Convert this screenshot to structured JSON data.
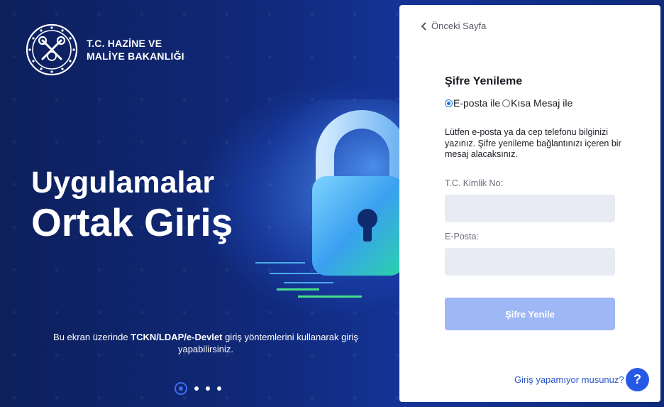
{
  "brand": {
    "name_line1": "T.C. HAZİNE VE",
    "name_line2": "MALİYE BAKANLIĞI"
  },
  "hero": {
    "title_line1": "Uygulamalar",
    "title_line2": "Ortak Giriş",
    "desc_prefix": "Bu ekran üzerinde ",
    "desc_bold": "TCKN/LDAP/e-Devlet",
    "desc_suffix": " giriş yöntemlerini kullanarak giriş yapabilirsiniz.",
    "slides_count": 4,
    "active_slide": 1
  },
  "card": {
    "back_label": "Önceki Sayfa",
    "title": "Şifre Yenileme",
    "radio_email": "E-posta ile",
    "radio_sms": "Kısa Mesaj ile",
    "selected_method": "email",
    "info_text": "Lütfen e-posta ya da cep telefonu bilginizi yazınız. Şifre yenileme bağlantınızı içeren bir mesaj alacaksınız.",
    "tckn_label": "T.C. Kimlik No:",
    "tckn_value": "",
    "email_label": "E-Posta:",
    "email_value": "",
    "submit_label": "Şifre Yenile",
    "help_link": "Giriş yapamıyor musunuz?",
    "help_icon": "?"
  },
  "colors": {
    "hero_bg": "#10297a",
    "accent": "#2658e6",
    "button_disabled": "#9eb7f5",
    "input_bg": "#e8ebf3",
    "link": "#2a56c6"
  }
}
